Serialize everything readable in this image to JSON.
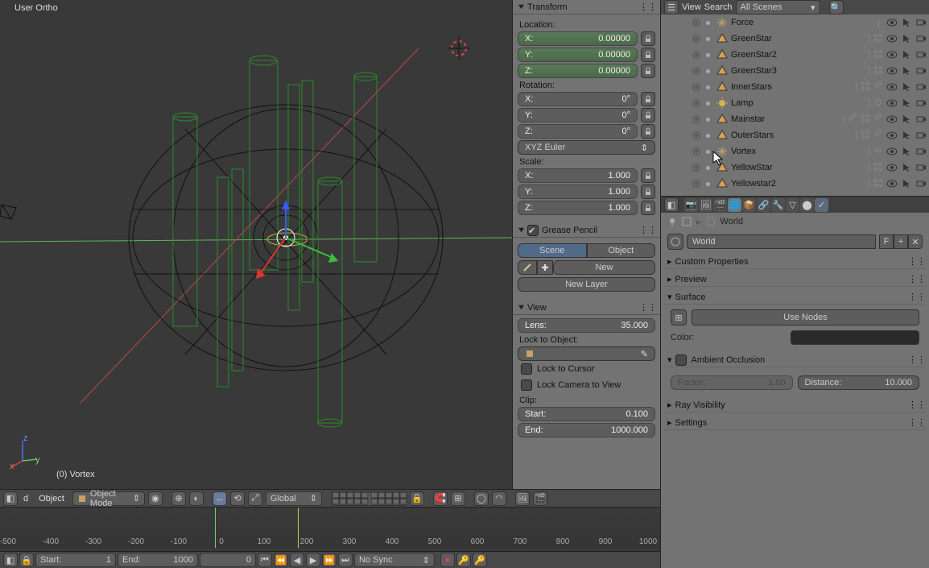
{
  "viewport": {
    "label": "User Ortho",
    "current_object": "(0) Vortex"
  },
  "transform": {
    "title": "Transform",
    "location": {
      "label": "Location:",
      "x_label": "X:",
      "x_val": "0.00000",
      "y_label": "Y:",
      "y_val": "0.00000",
      "z_label": "Z:",
      "z_val": "0.00000"
    },
    "rotation": {
      "label": "Rotation:",
      "x_label": "X:",
      "x_val": "0°",
      "y_label": "Y:",
      "y_val": "0°",
      "z_label": "Z:",
      "z_val": "0°",
      "mode": "XYZ Euler"
    },
    "scale": {
      "label": "Scale:",
      "x_label": "X:",
      "x_val": "1.000",
      "y_label": "Y:",
      "y_val": "1.000",
      "z_label": "Z:",
      "z_val": "1.000"
    }
  },
  "grease": {
    "title": "Grease Pencil",
    "scene": "Scene",
    "object": "Object",
    "new": "New",
    "new_layer": "New Layer"
  },
  "view": {
    "title": "View",
    "lens_label": "Lens:",
    "lens_val": "35.000",
    "lock_obj": "Lock to Object:",
    "lock_cursor": "Lock to Cursor",
    "lock_cam": "Lock Camera to View",
    "clip": "Clip:",
    "start_label": "Start:",
    "start_val": "0.100",
    "end_label": "End:",
    "end_val": "1000.000"
  },
  "toolbar": {
    "mode": "Object Mode",
    "menu_object": "Object",
    "orient": "Global",
    "d": "d"
  },
  "timeline": {
    "ticks": [
      "-500",
      "-400",
      "-300",
      "-200",
      "-100",
      "0",
      "100",
      "200",
      "300",
      "400",
      "500",
      "600",
      "700",
      "800",
      "900",
      "1000"
    ],
    "start_label": "Start:",
    "start_val": "1",
    "end_label": "End:",
    "end_val": "1000",
    "cur_frame": "0",
    "sync": "No Sync"
  },
  "outliner": {
    "view": "View",
    "search": "Search",
    "filter": "All Scenes",
    "items": [
      {
        "icon": "empty",
        "name": "Force",
        "mods": []
      },
      {
        "icon": "mesh",
        "name": "GreenStar",
        "mods": [
          "mod"
        ]
      },
      {
        "icon": "mesh",
        "name": "GreenStar2",
        "mods": [
          "mod"
        ]
      },
      {
        "icon": "mesh",
        "name": "GreenStar3",
        "mods": [
          "mod"
        ]
      },
      {
        "icon": "mesh",
        "name": "InnerStars",
        "mods": [
          "mod",
          "wrench"
        ]
      },
      {
        "icon": "lamp",
        "name": "Lamp",
        "mods": [
          "lamp-data"
        ]
      },
      {
        "icon": "mesh",
        "name": "Mainstar",
        "mods": [
          "wrench",
          "mod",
          "wrench"
        ]
      },
      {
        "icon": "mesh",
        "name": "OuterStars",
        "mods": [
          "mod",
          "wrench"
        ]
      },
      {
        "icon": "empty",
        "name": "Vortex",
        "mods": [
          "phys"
        ]
      },
      {
        "icon": "mesh",
        "name": "YellowStar",
        "mods": [
          "mod"
        ]
      },
      {
        "icon": "mesh",
        "name": "Yellowstar2",
        "mods": [
          "mod"
        ]
      }
    ]
  },
  "world": {
    "breadcrumb": "World",
    "name": "World",
    "fake": "F",
    "plus": "+",
    "x": "✕",
    "custom_props": "Custom Properties",
    "preview": "Preview",
    "surface": "Surface",
    "use_nodes": "Use Nodes",
    "color": "Color:",
    "ao": "Ambient Occlusion",
    "factor_label": "Factor:",
    "factor_val": "1.00",
    "distance_label": "Distance:",
    "distance_val": "10.000",
    "ray": "Ray Visibility",
    "settings": "Settings"
  }
}
